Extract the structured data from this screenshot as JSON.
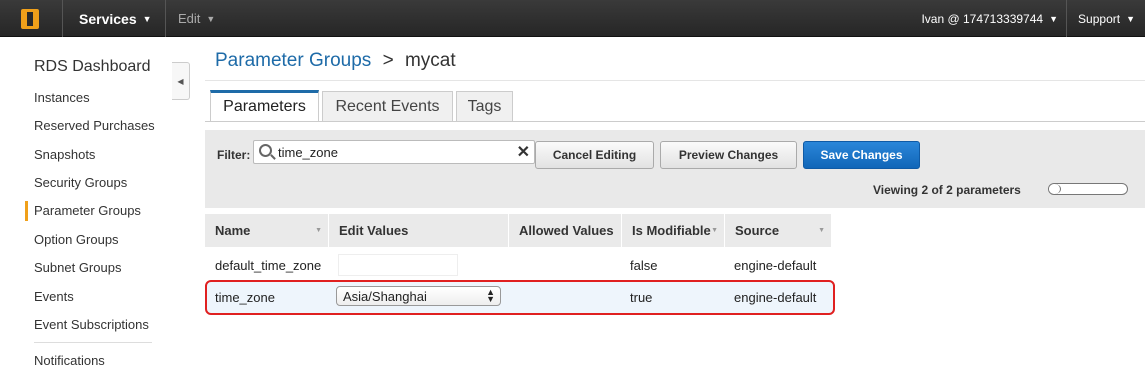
{
  "topbar": {
    "services_label": "Services",
    "edit_label": "Edit",
    "account_label": "Ivan @ 174713339744",
    "support_label": "Support"
  },
  "sidebar": {
    "title": "RDS Dashboard",
    "items": [
      {
        "label": "Instances"
      },
      {
        "label": "Reserved Purchases"
      },
      {
        "label": "Snapshots"
      },
      {
        "label": "Security Groups"
      },
      {
        "label": "Parameter Groups",
        "active": true
      },
      {
        "label": "Option Groups"
      },
      {
        "label": "Subnet Groups"
      },
      {
        "label": "Events"
      },
      {
        "label": "Event Subscriptions"
      },
      {
        "label": "Notifications"
      }
    ]
  },
  "breadcrumb": {
    "link": "Parameter Groups",
    "separator": ">",
    "current": "mycat"
  },
  "tabs": [
    {
      "label": "Parameters",
      "active": true
    },
    {
      "label": "Recent Events"
    },
    {
      "label": "Tags"
    }
  ],
  "toolbar": {
    "filter_label": "Filter:",
    "filter_value": "time_zone",
    "cancel_label": "Cancel Editing",
    "preview_label": "Preview Changes",
    "save_label": "Save Changes",
    "viewing_text": "Viewing 2 of 2 parameters"
  },
  "table": {
    "columns": [
      "Name",
      "Edit Values",
      "Allowed Values",
      "Is Modifiable",
      "Source"
    ],
    "rows": [
      {
        "name": "default_time_zone",
        "edit_value": "",
        "allowed": "",
        "modifiable": "false",
        "source": "engine-default"
      },
      {
        "name": "time_zone",
        "edit_value": "Asia/Shanghai",
        "allowed": "",
        "modifiable": "true",
        "source": "engine-default"
      }
    ]
  },
  "colors": {
    "accent": "#1e6ba8",
    "primary_button": "#1a73c8",
    "highlight_border": "#e02020",
    "active_marker": "#f0a01a"
  }
}
